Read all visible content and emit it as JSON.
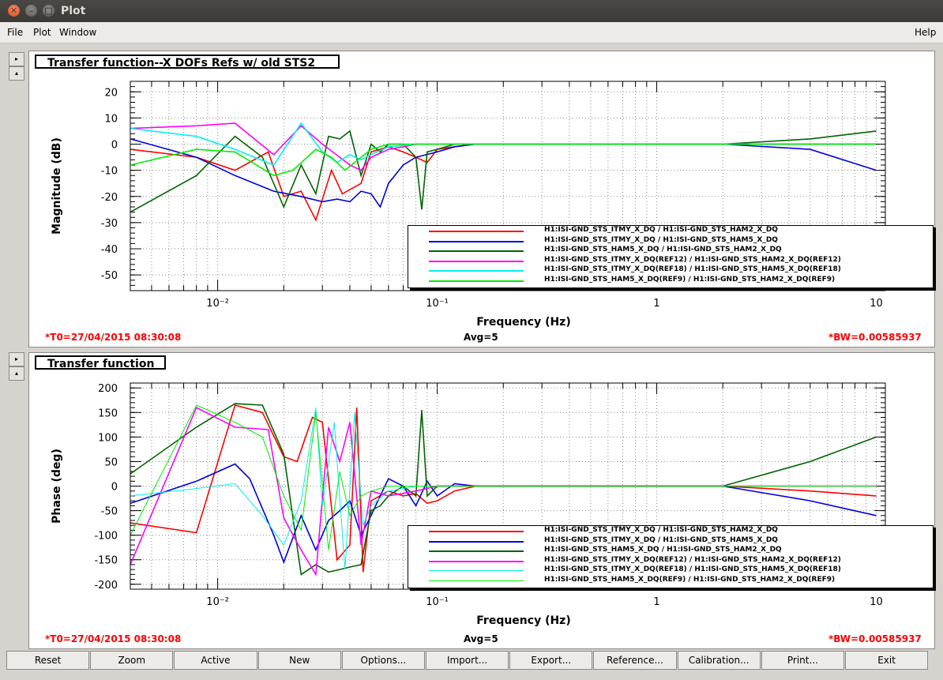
{
  "window": {
    "title": "Plot"
  },
  "menu": {
    "file": "File",
    "plot": "Plot",
    "window": "Window",
    "help": "Help"
  },
  "colors": {
    "red": "#ff0000",
    "blue": "#0000e0",
    "green": "#006400",
    "magenta": "#ff00ff",
    "cyan": "#00f0f0",
    "lime": "#00ee00"
  },
  "panels": [
    {
      "title": "Transfer function--X DOFs  Refs w/ old STS2",
      "t0": "*T0=27/04/2015 08:30:08",
      "avg": "Avg=5",
      "bw": "*BW=0.00585937"
    },
    {
      "title": "Transfer function",
      "t0": "*T0=27/04/2015 08:30:08",
      "avg": "Avg=5",
      "bw": "*BW=0.00585937"
    }
  ],
  "legend": [
    "H1:ISI-GND_STS_ITMY_X_DQ / H1:ISI-GND_STS_HAM2_X_DQ",
    "H1:ISI-GND_STS_ITMY_X_DQ / H1:ISI-GND_STS_HAM5_X_DQ",
    "H1:ISI-GND_STS_HAM5_X_DQ / H1:ISI-GND_STS_HAM2_X_DQ",
    "H1:ISI-GND_STS_ITMY_X_DQ(REF12) / H1:ISI-GND_STS_HAM2_X_DQ(REF12)",
    "H1:ISI-GND_STS_ITMY_X_DQ(REF18) / H1:ISI-GND_STS_HAM5_X_DQ(REF18)",
    "H1:ISI-GND_STS_HAM5_X_DQ(REF9) / H1:ISI-GND_STS_HAM2_X_DQ(REF9)"
  ],
  "buttons": [
    "Reset",
    "Zoom",
    "Active",
    "New",
    "Options...",
    "Import...",
    "Export...",
    "Reference...",
    "Calibration...",
    "Print...",
    "Exit"
  ],
  "chart_data": [
    {
      "type": "line",
      "xlabel": "Frequency (Hz)",
      "ylabel": "Magnitude (dB)",
      "xscale": "log",
      "xlim": [
        0.004,
        11
      ],
      "ylim": [
        -56,
        24
      ],
      "yticks": [
        20,
        10,
        0,
        -10,
        -20,
        -30,
        -40,
        -50
      ],
      "xticklabels": [
        "10⁻²",
        "10⁻¹",
        "1",
        "10"
      ],
      "grid": true,
      "legend_position": "bottom-right",
      "series": [
        {
          "color": "red",
          "x": [
            0.004,
            0.008,
            0.012,
            0.017,
            0.02,
            0.024,
            0.028,
            0.033,
            0.037,
            0.045,
            0.05,
            0.06,
            0.07,
            0.08,
            0.09,
            0.1,
            0.12,
            0.15,
            0.2,
            0.5,
            1,
            2,
            5,
            10
          ],
          "y": [
            -2,
            -5,
            -10,
            -3,
            -20,
            -18,
            -29,
            -10,
            -19,
            -15,
            -3,
            -1,
            -3,
            -5,
            -7,
            -2,
            -1,
            0,
            0,
            0,
            0,
            0,
            0,
            0
          ]
        },
        {
          "color": "blue",
          "x": [
            0.004,
            0.008,
            0.012,
            0.018,
            0.024,
            0.03,
            0.035,
            0.04,
            0.045,
            0.05,
            0.055,
            0.06,
            0.07,
            0.08,
            0.1,
            0.12,
            0.15,
            0.2,
            0.5,
            1,
            2,
            5,
            10
          ],
          "y": [
            2,
            -5,
            -12,
            -18,
            -20,
            -22,
            -21,
            -22,
            -18,
            -19,
            -24,
            -15,
            -8,
            -5,
            -3,
            -1,
            0,
            0,
            0,
            0,
            0,
            -2,
            -10
          ]
        },
        {
          "color": "green",
          "x": [
            0.004,
            0.008,
            0.012,
            0.016,
            0.02,
            0.024,
            0.028,
            0.032,
            0.036,
            0.04,
            0.045,
            0.05,
            0.055,
            0.06,
            0.07,
            0.08,
            0.085,
            0.09,
            0.1,
            0.12,
            0.15,
            0.2,
            0.5,
            1,
            2,
            5,
            10
          ],
          "y": [
            -26,
            -12,
            3,
            -5,
            -24,
            -8,
            -19,
            3,
            2,
            5,
            -12,
            0,
            -3,
            0,
            0,
            -5,
            -25,
            -3,
            -2,
            0,
            0,
            0,
            0,
            0,
            0,
            2,
            5
          ]
        },
        {
          "color": "magenta",
          "x": [
            0.004,
            0.008,
            0.012,
            0.018,
            0.024,
            0.03,
            0.036,
            0.04,
            0.045,
            0.05,
            0.06,
            0.07,
            0.08,
            0.1,
            0.12,
            0.15,
            0.2,
            0.5,
            1,
            2,
            5,
            10
          ],
          "y": [
            6,
            7,
            8,
            -4,
            7,
            0,
            -5,
            -8,
            -10,
            -5,
            -2,
            -1,
            0,
            0,
            0,
            0,
            0,
            0,
            0,
            0,
            0,
            0
          ]
        },
        {
          "color": "cyan",
          "x": [
            0.004,
            0.008,
            0.012,
            0.018,
            0.024,
            0.03,
            0.035,
            0.04,
            0.045,
            0.05,
            0.06,
            0.08,
            0.1,
            0.12,
            0.15,
            0.2,
            0.5,
            1,
            2,
            5,
            10
          ],
          "y": [
            6,
            3,
            -2,
            -8,
            8,
            -3,
            -7,
            -4,
            -6,
            -4,
            -1,
            0,
            0,
            0,
            0,
            0,
            0,
            0,
            0,
            0,
            0
          ]
        },
        {
          "color": "lime",
          "x": [
            0.004,
            0.008,
            0.012,
            0.018,
            0.022,
            0.028,
            0.033,
            0.038,
            0.045,
            0.05,
            0.06,
            0.08,
            0.1,
            0.12,
            0.15,
            0.2,
            0.5,
            1,
            2,
            5,
            10
          ],
          "y": [
            -8,
            -2,
            -3,
            -12,
            -10,
            -2,
            -5,
            -10,
            -5,
            -2,
            0,
            0,
            0,
            0,
            0,
            0,
            0,
            0,
            0,
            0,
            0
          ]
        }
      ]
    },
    {
      "type": "line",
      "xlabel": "Frequency (Hz)",
      "ylabel": "Phase (deg)",
      "xscale": "log",
      "xlim": [
        0.004,
        11
      ],
      "ylim": [
        -210,
        210
      ],
      "yticks": [
        200,
        150,
        100,
        50,
        0,
        -50,
        -100,
        -150,
        -200
      ],
      "xticklabels": [
        "10⁻²",
        "10⁻¹",
        "1",
        "10"
      ],
      "grid": true,
      "legend_position": "bottom-right",
      "series": [
        {
          "color": "red",
          "x": [
            0.004,
            0.008,
            0.012,
            0.016,
            0.02,
            0.023,
            0.027,
            0.03,
            0.035,
            0.04,
            0.043,
            0.046,
            0.05,
            0.06,
            0.07,
            0.08,
            0.09,
            0.1,
            0.12,
            0.15,
            0.2,
            0.5,
            1,
            2,
            5,
            10
          ],
          "y": [
            -75,
            -95,
            165,
            150,
            60,
            50,
            140,
            130,
            -150,
            -120,
            160,
            -175,
            -30,
            -10,
            -20,
            -15,
            -35,
            -30,
            -10,
            0,
            0,
            0,
            0,
            0,
            -10,
            -20
          ]
        },
        {
          "color": "blue",
          "x": [
            0.004,
            0.008,
            0.012,
            0.014,
            0.018,
            0.02,
            0.024,
            0.028,
            0.032,
            0.036,
            0.04,
            0.045,
            0.05,
            0.055,
            0.06,
            0.07,
            0.08,
            0.09,
            0.1,
            0.12,
            0.15,
            0.2,
            0.5,
            1,
            2,
            5,
            10
          ],
          "y": [
            -35,
            10,
            45,
            15,
            -100,
            -155,
            -60,
            -130,
            -70,
            -50,
            -30,
            -100,
            -60,
            -20,
            15,
            0,
            -40,
            10,
            -20,
            5,
            0,
            0,
            0,
            0,
            0,
            -30,
            -60
          ]
        },
        {
          "color": "green",
          "x": [
            0.004,
            0.008,
            0.012,
            0.016,
            0.02,
            0.024,
            0.028,
            0.032,
            0.036,
            0.04,
            0.045,
            0.05,
            0.055,
            0.06,
            0.07,
            0.08,
            0.085,
            0.09,
            0.1,
            0.12,
            0.15,
            0.2,
            0.5,
            1,
            2,
            5,
            10
          ],
          "y": [
            25,
            120,
            168,
            165,
            65,
            -180,
            -160,
            -175,
            -170,
            -165,
            -160,
            -50,
            -40,
            -20,
            0,
            -20,
            155,
            -20,
            0,
            0,
            0,
            0,
            0,
            0,
            0,
            50,
            100
          ]
        },
        {
          "color": "magenta",
          "x": [
            0.004,
            0.008,
            0.012,
            0.017,
            0.02,
            0.024,
            0.028,
            0.032,
            0.036,
            0.04,
            0.045,
            0.05,
            0.06,
            0.08,
            0.1,
            0.12,
            0.15,
            0.2,
            0.5,
            1,
            2,
            5,
            10
          ],
          "y": [
            -160,
            160,
            120,
            115,
            -65,
            -130,
            -180,
            120,
            50,
            130,
            -120,
            -10,
            -20,
            -10,
            0,
            0,
            0,
            0,
            0,
            0,
            0,
            0,
            0
          ]
        },
        {
          "color": "cyan",
          "x": [
            0.004,
            0.008,
            0.012,
            0.016,
            0.02,
            0.024,
            0.028,
            0.03,
            0.034,
            0.038,
            0.042,
            0.046,
            0.05,
            0.06,
            0.08,
            0.1,
            0.12,
            0.15,
            0.2,
            0.5,
            1,
            2,
            5,
            10
          ],
          "y": [
            -20,
            -5,
            5,
            -60,
            -120,
            -30,
            160,
            -40,
            130,
            -170,
            150,
            -80,
            -40,
            -10,
            0,
            0,
            0,
            0,
            0,
            0,
            0,
            0,
            0,
            0
          ]
        },
        {
          "color": "lime",
          "x": [
            0.004,
            0.008,
            0.012,
            0.016,
            0.02,
            0.024,
            0.028,
            0.032,
            0.036,
            0.04,
            0.045,
            0.05,
            0.06,
            0.08,
            0.1,
            0.12,
            0.15,
            0.2,
            0.5,
            1,
            2,
            5,
            10
          ],
          "y": [
            -100,
            165,
            130,
            100,
            -20,
            -90,
            150,
            -130,
            30,
            -60,
            -20,
            -10,
            0,
            0,
            0,
            0,
            0,
            0,
            0,
            0,
            0,
            0,
            0
          ]
        }
      ]
    }
  ]
}
